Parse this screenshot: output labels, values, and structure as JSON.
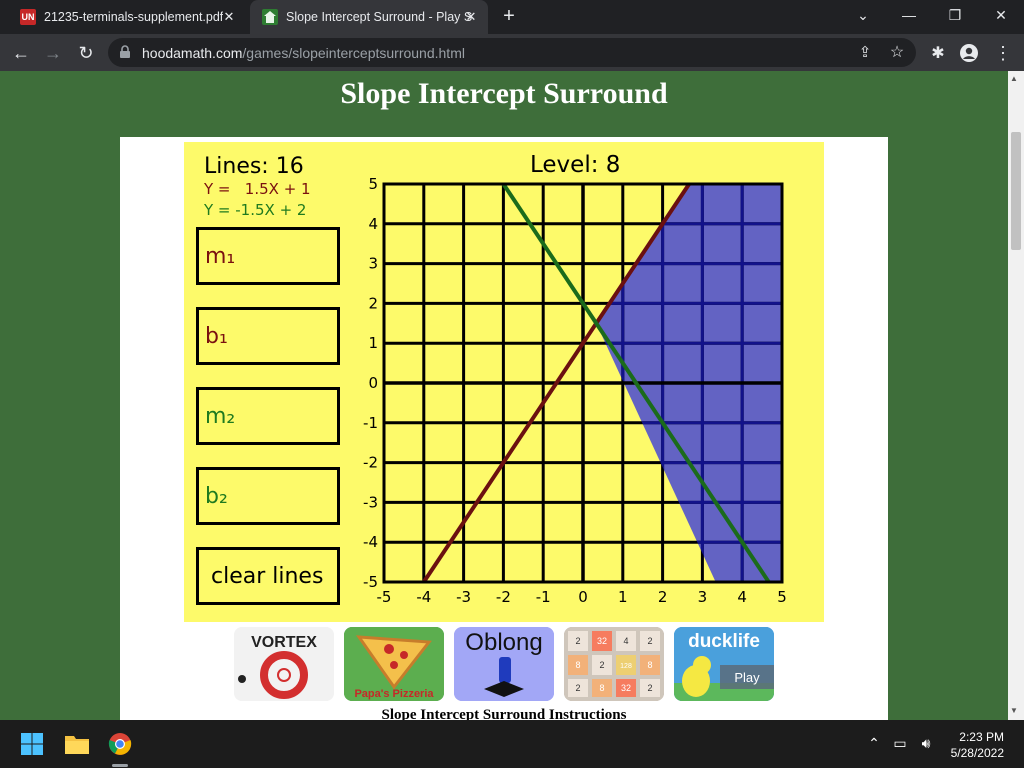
{
  "browser": {
    "tabs": [
      {
        "favicon": "UN",
        "title": "21235-terminals-supplement.pdf",
        "active": false
      },
      {
        "favicon": "hooda",
        "title": "Slope Intercept Surround - Play S",
        "active": true
      }
    ],
    "url_domain": "hoodamath.com",
    "url_path": "/games/slopeinterceptsurround.html"
  },
  "page": {
    "title": "Slope Intercept Surround",
    "instructions_heading": "Slope Intercept Surround Instructions"
  },
  "game": {
    "lines_label": "Lines: 16",
    "equation1": "Y =   1.5X + 1",
    "equation2": "Y = -1.5X + 2",
    "level_label": "Level: 8",
    "buttons": {
      "m1": "m₁",
      "b1": "b₁",
      "m2": "m₂",
      "b2": "b₂",
      "clear": "clear lines"
    },
    "colors": {
      "line1": "#6b1010",
      "line2": "#1b6b1b",
      "shade": "#5b5bc8",
      "background": "#fdfa6a"
    }
  },
  "chart_data": {
    "type": "line",
    "title": "Level: 8",
    "xlim": [
      -5,
      5
    ],
    "ylim": [
      -5,
      5
    ],
    "x_ticks": [
      "-5",
      "-4",
      "-3",
      "-2",
      "-1",
      "0",
      "1",
      "2",
      "3",
      "4",
      "5"
    ],
    "y_ticks": [
      "5",
      "4",
      "3",
      "2",
      "1",
      "0",
      "-1",
      "-2",
      "-3",
      "-4",
      "-5"
    ],
    "grid": true,
    "series": [
      {
        "equation": "Y =   1.5X + 1",
        "slope": 1.5,
        "intercept": 1,
        "color": "#6b1010"
      },
      {
        "equation": "Y = -1.5X + 2",
        "slope": -1.5,
        "intercept": 2,
        "color": "#1b6b1b"
      }
    ],
    "shaded_region": [
      [
        0.333,
        1.5
      ],
      [
        2.667,
        5
      ],
      [
        5,
        5
      ],
      [
        5,
        -5
      ],
      [
        3.333,
        -5
      ]
    ]
  },
  "thumbnails": [
    {
      "name": "vortex",
      "label": "VORTEX"
    },
    {
      "name": "papas-pizzeria",
      "label": "Papa's Pizzeria"
    },
    {
      "name": "oblong",
      "label": "Oblong"
    },
    {
      "name": "2048",
      "label": ""
    },
    {
      "name": "ducklife",
      "label": "ducklife",
      "play": "Play"
    }
  ],
  "taskbar": {
    "time": "2:23 PM",
    "date": "5/28/2022"
  }
}
